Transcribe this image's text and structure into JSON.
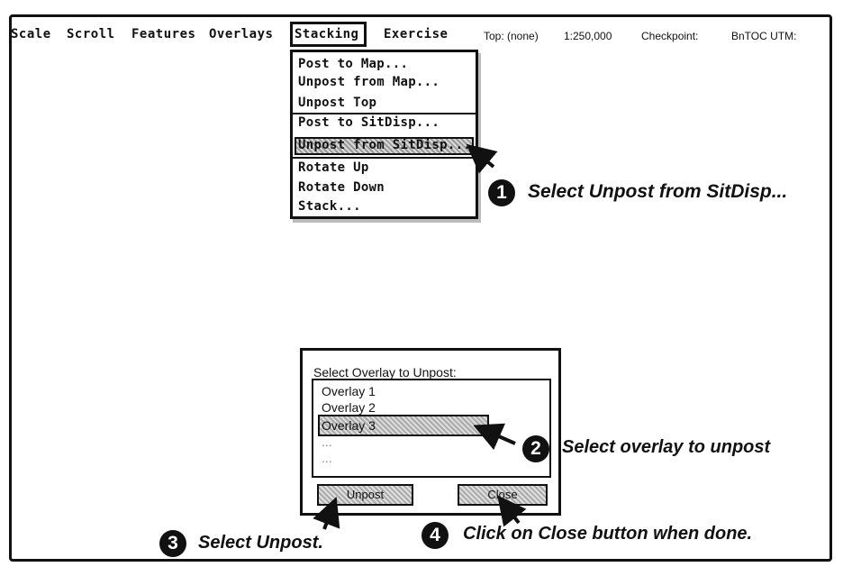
{
  "menubar": {
    "items": [
      "Scale",
      "Scroll",
      "Features",
      "Overlays",
      "Stacking",
      "Exercise"
    ],
    "status": [
      "Top: (none)",
      "1:250,000",
      "Checkpoint:",
      "BnTOC UTM:"
    ]
  },
  "stacking_menu": {
    "items": [
      "Post to Map...",
      "Unpost from Map...",
      "Unpost Top",
      "Post to SitDisp...",
      "Unpost from SitDisp...",
      "Rotate Up",
      "Rotate Down",
      "Stack..."
    ],
    "selected": "Unpost from SitDisp..."
  },
  "dialog": {
    "title": "Select Overlay to Unpost:",
    "list": [
      "Overlay 1",
      "Overlay 2",
      "Overlay 3",
      "...",
      "..."
    ],
    "selected": "Overlay 3",
    "unpost_label": "Unpost",
    "close_label": "Close"
  },
  "steps": [
    {
      "number": "1",
      "text": "Select Unpost from SitDisp..."
    },
    {
      "number": "2",
      "text": "Select overlay to unpost"
    },
    {
      "number": "3",
      "text": "Select Unpost."
    },
    {
      "number": "4",
      "text": "Click on Close button when done."
    }
  ]
}
